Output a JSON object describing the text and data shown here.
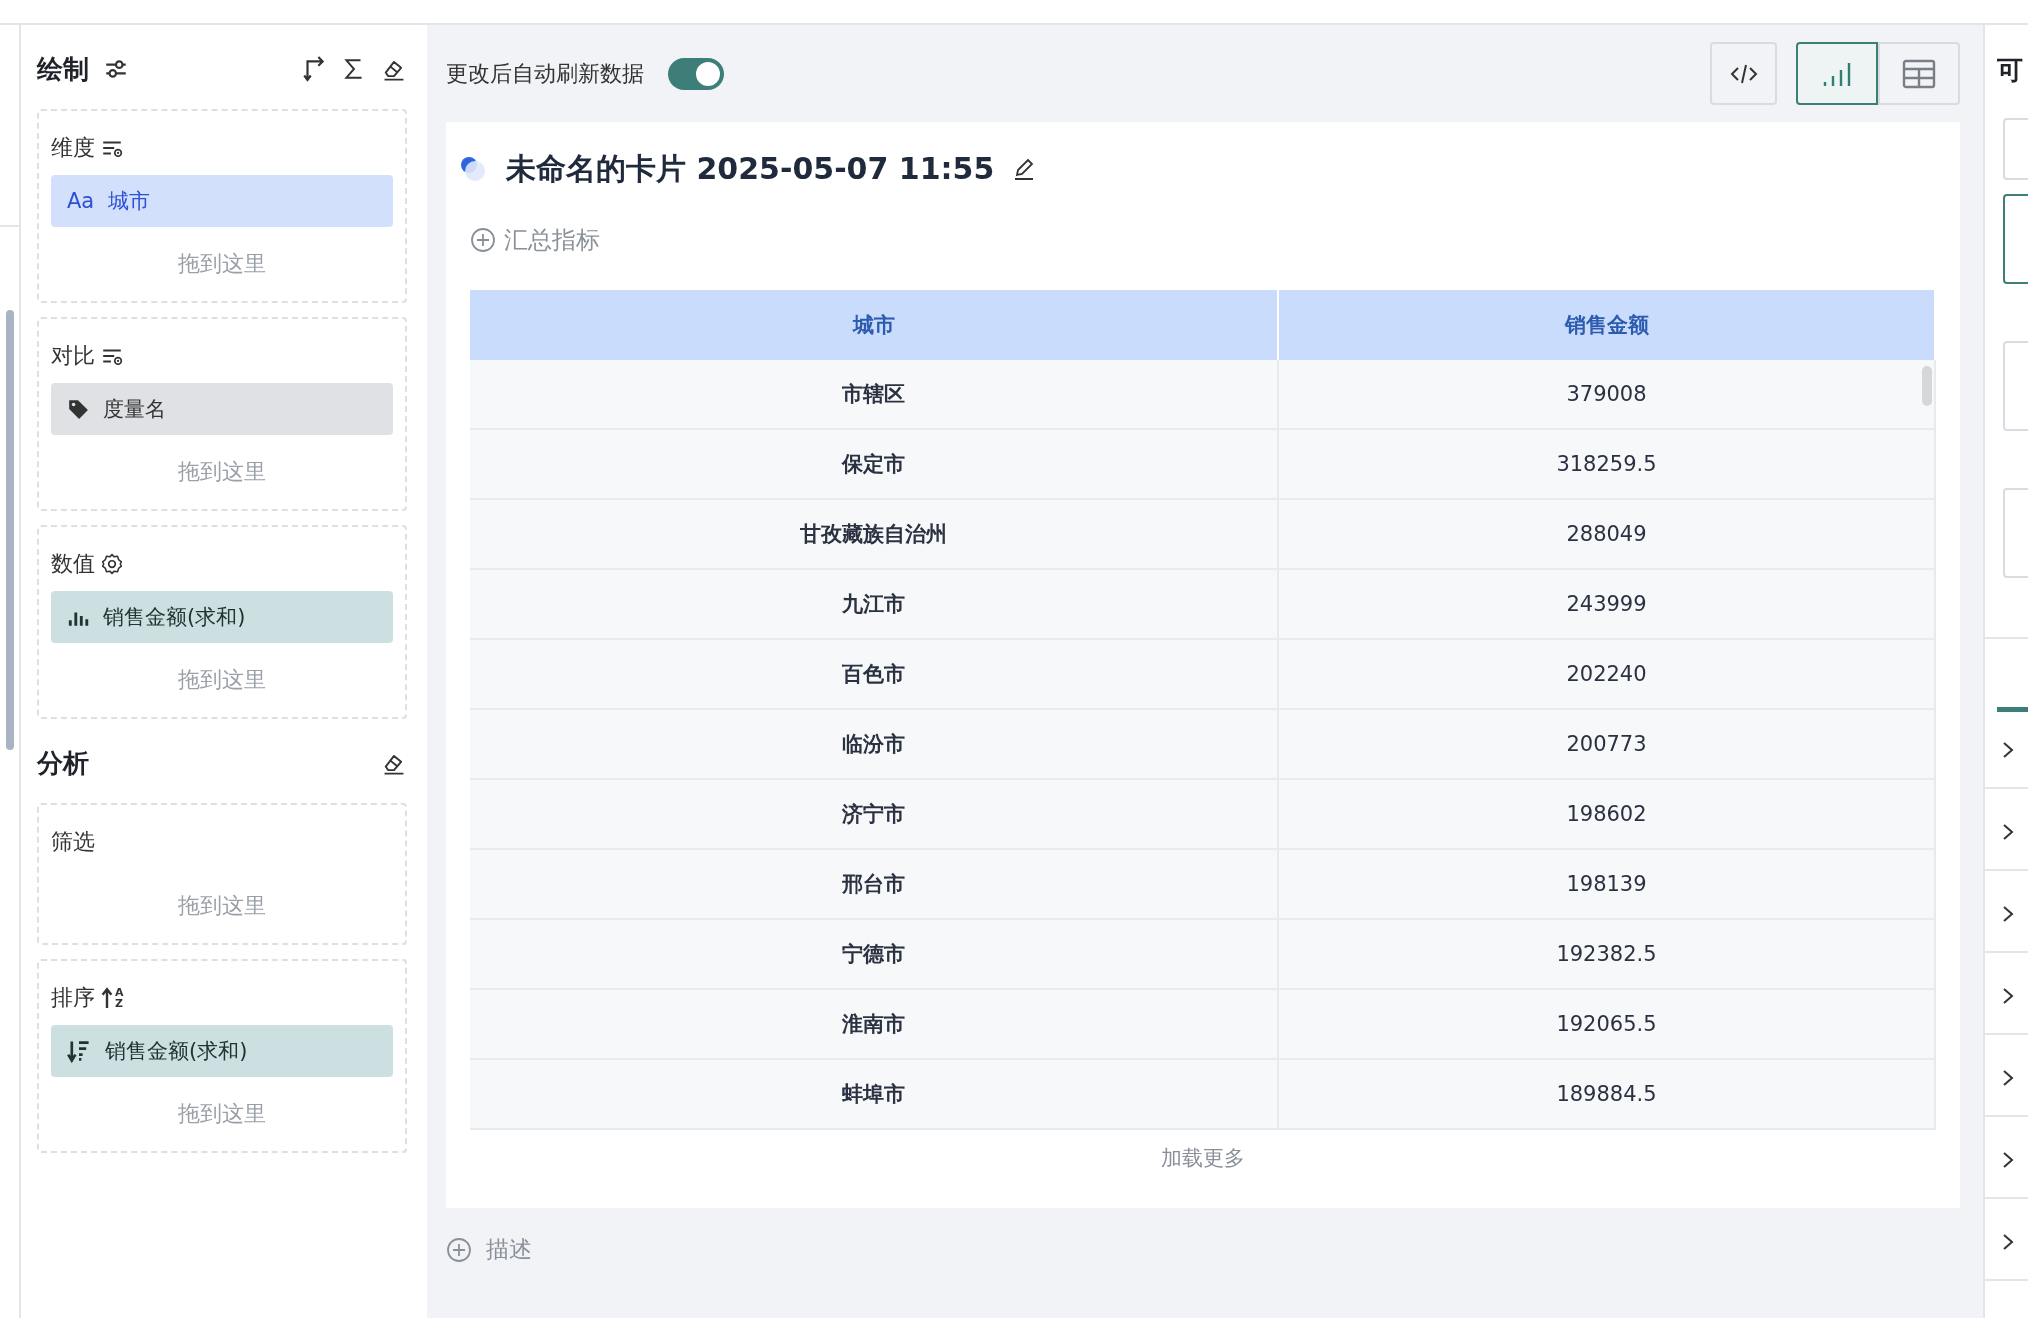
{
  "draw_panel": {
    "title": "绘制",
    "sections": [
      {
        "kind": "dimension",
        "label": "维度",
        "fields": [
          {
            "kind": "text",
            "type_glyph": "Aa",
            "label": "城市"
          }
        ],
        "drop_hint": "拖到这里"
      },
      {
        "kind": "compare",
        "label": "对比",
        "fields": [
          {
            "kind": "tag",
            "label": "度量名"
          }
        ],
        "drop_hint": "拖到这里"
      },
      {
        "kind": "value",
        "label": "数值",
        "fields": [
          {
            "kind": "measure",
            "label": "销售金额(求和)"
          }
        ],
        "drop_hint": "拖到这里"
      }
    ]
  },
  "analysis_panel": {
    "title": "分析",
    "sections": [
      {
        "kind": "filter",
        "label": "筛选",
        "drop_hint": "拖到这里"
      },
      {
        "kind": "sort",
        "label": "排序",
        "order_letters": "AZ",
        "fields": [
          {
            "kind": "sort",
            "label": "销售金额(求和)"
          }
        ],
        "drop_hint": "拖到这里"
      }
    ]
  },
  "toolbar": {
    "auto_refresh": {
      "label": "更改后自动刷新数据",
      "on": true
    },
    "views": [
      {
        "kind": "chart",
        "selected": true
      },
      {
        "kind": "table",
        "selected": false
      }
    ]
  },
  "card": {
    "title": "未命名的卡片 2025-05-07 11:55",
    "add_metric": "汇总指标",
    "table": {
      "columns": [
        "城市",
        "销售金额"
      ],
      "rows": [
        [
          "市辖区",
          "379008"
        ],
        [
          "保定市",
          "318259.5"
        ],
        [
          "甘孜藏族自治州",
          "288049"
        ],
        [
          "九江市",
          "243999"
        ],
        [
          "百色市",
          "202240"
        ],
        [
          "临汾市",
          "200773"
        ],
        [
          "济宁市",
          "198602"
        ],
        [
          "邢台市",
          "198139"
        ],
        [
          "宁德市",
          "192382.5"
        ],
        [
          "淮南市",
          "192065.5"
        ],
        [
          "蚌埠市",
          "189884.5"
        ]
      ]
    },
    "load_more": "加载更多"
  },
  "add_description": "描述",
  "right_panel": {
    "title": "可",
    "boxes": [
      {
        "selected": false
      },
      {
        "selected": true
      },
      {
        "selected": false
      },
      {
        "selected": false
      }
    ]
  }
}
